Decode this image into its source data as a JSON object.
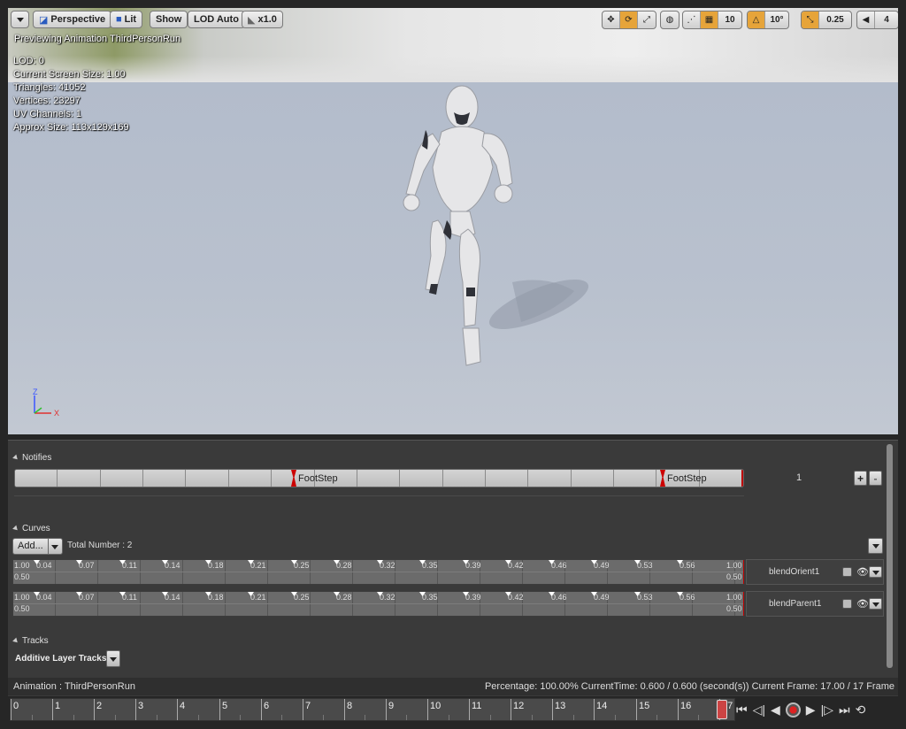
{
  "viewport": {
    "toolbar": {
      "perspective": "Perspective",
      "lit": "Lit",
      "show": "Show",
      "lod": "LOD Auto",
      "speed": "x1.0",
      "grid_snap": "10",
      "angle_snap": "10°",
      "scale_snap": "0.25",
      "camera_speed": "4"
    },
    "title": "Previewing Animation ThirdPersonRun",
    "stats": [
      "LOD: 0",
      "Current Screen Size: 1.00",
      "Triangles: 41052",
      "Vertices: 23297",
      "UV Channels: 1",
      "Approx Size: 113x129x169"
    ],
    "axis": {
      "z": "Z",
      "x": "X"
    }
  },
  "notifies": {
    "header": "Notifies",
    "events": [
      "FootStep",
      "FootStep"
    ],
    "track_count": "1",
    "add": "+",
    "remove": "-"
  },
  "curves": {
    "header": "Curves",
    "add_label": "Add...",
    "total": "Total Number : 2",
    "tick_labels": [
      "0.04",
      "0.07",
      "0.11",
      "0.14",
      "0.18",
      "0.21",
      "0.25",
      "0.28",
      "0.32",
      "0.35",
      "0.39",
      "0.42",
      "0.46",
      "0.49",
      "0.53",
      "0.56"
    ],
    "top_value": "1.00",
    "mid_value": "0.50",
    "items": [
      {
        "name": "blendOrient1",
        "eye": "👁"
      },
      {
        "name": "blendParent1",
        "eye": "👁"
      }
    ]
  },
  "tracks": {
    "header": "Tracks",
    "additive": "Additive Layer Tracks"
  },
  "status": {
    "animation": "Animation :  ThirdPersonRun",
    "percentage": "Percentage:  100.00% CurrentTime:  0.600 / 0.600 (second(s)) Current Frame:  17.00 / 17 Frame"
  },
  "timeline": {
    "frames": [
      "0",
      "1",
      "2",
      "3",
      "4",
      "5",
      "6",
      "7",
      "8",
      "9",
      "10",
      "11",
      "12",
      "13",
      "14",
      "15",
      "16",
      "17"
    ]
  },
  "colors": {
    "accent": "#e6a43a",
    "notify_marker": "#cc0000",
    "panel_bg": "#3a3a3a"
  }
}
